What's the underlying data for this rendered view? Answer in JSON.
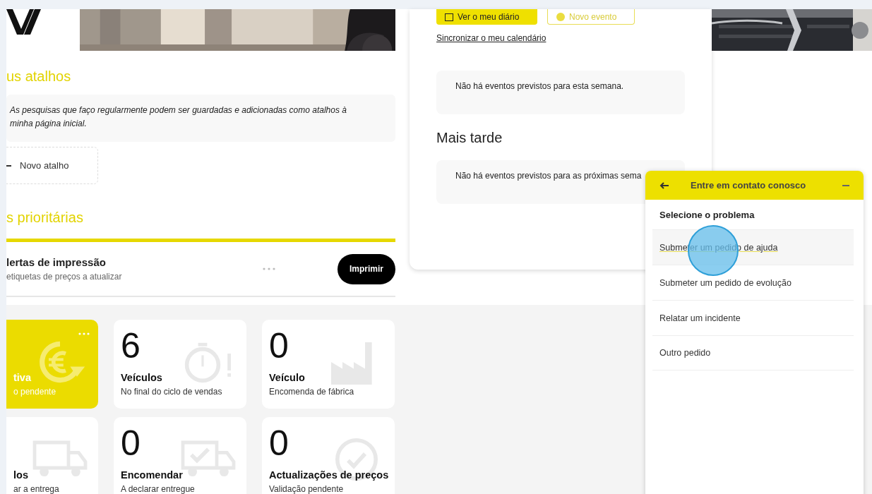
{
  "shortcuts": {
    "heading": "us atalhos",
    "info": "As pesquisas que faço regularmente podem ser guardadas e adicionadas como atalhos à minha página inicial.",
    "new_button": "Novo atalho"
  },
  "priorities": {
    "heading": "s prioritárias",
    "alert": {
      "title": "lertas de impressão",
      "subtitle": "etiquetas de preços a atualizar",
      "action": "Imprimir"
    }
  },
  "tiles": [
    {
      "kind": "highlight",
      "title": "tiva",
      "subtitle": "o pendente"
    },
    {
      "kind": "plain",
      "count": "6",
      "title": "Veículos",
      "subtitle": "No final do ciclo de vendas"
    },
    {
      "kind": "plain",
      "count": "0",
      "title": "Veículo",
      "subtitle": "Encomenda de fábrica"
    },
    {
      "kind": "plain",
      "title": "los",
      "subtitle": "ar a entrega"
    },
    {
      "kind": "plain",
      "count": "0",
      "title": "Encomendar",
      "subtitle": "A declarar entregue"
    },
    {
      "kind": "plain",
      "count": "0",
      "title": "Actualizações de preços",
      "subtitle": "Validação pendente"
    }
  ],
  "agenda": {
    "buttons": [
      {
        "kind": "primary",
        "label": "Ver o meu diário"
      },
      {
        "kind": "outline",
        "label": "Novo evento"
      }
    ],
    "sync_link": "Sincronizar o meu calendário",
    "this_week": "Não há eventos previstos para esta semana.",
    "later_heading": "Mais tarde",
    "later": "Não há eventos previstos para as próximas sema"
  },
  "contact_panel": {
    "title": "Entre em contato conosco",
    "prompt": "Selecione o problema",
    "items": [
      {
        "label": "Submeter um pedido de ajuda",
        "selected": true
      },
      {
        "label": "Submeter um pedido de evolução",
        "selected": false
      },
      {
        "label": "Relatar um incidente",
        "selected": false
      },
      {
        "label": "Outro pedido",
        "selected": false
      }
    ]
  }
}
